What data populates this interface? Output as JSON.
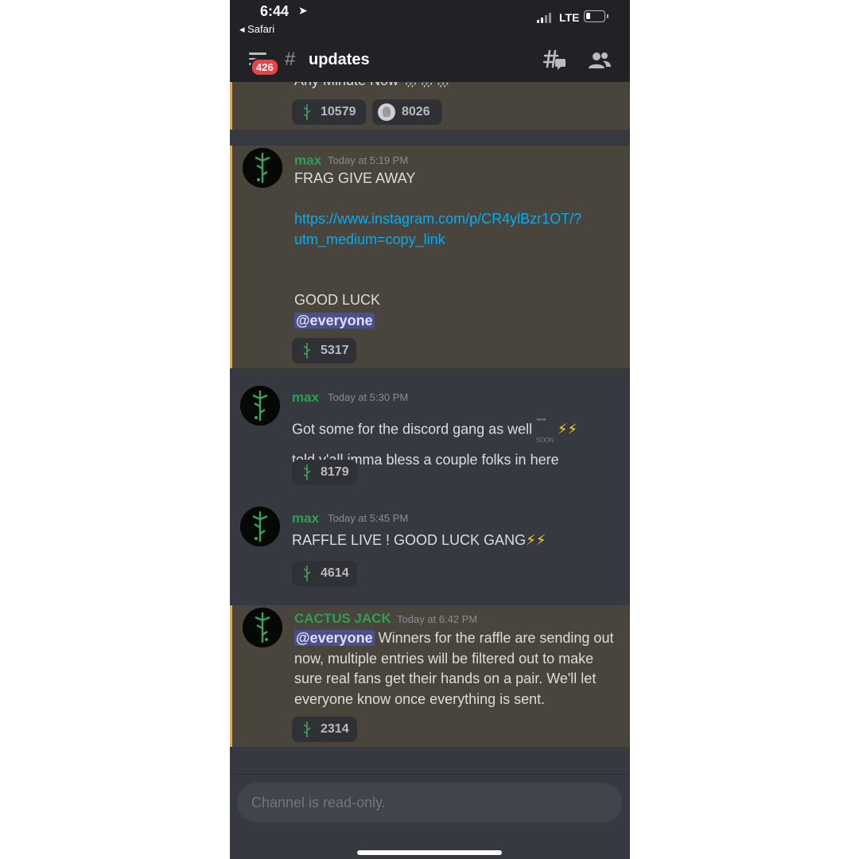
{
  "status_bar": {
    "time": "6:44",
    "back_label": "◂ Safari",
    "network": "LTE"
  },
  "header": {
    "mention_count": "426",
    "channel_prefix": "#",
    "channel_name": "updates"
  },
  "icons": {
    "menu": "hamburger-icon",
    "threads": "threads-icon",
    "members": "members-icon",
    "reaction": "cactus-emoji"
  },
  "messages": [
    {
      "partial_text": "Any Minute Now",
      "partial_emoji": "🌧🌧🌧",
      "reactions": [
        {
          "emoji": "cactus",
          "count": "10579"
        },
        {
          "emoji": "shell",
          "count": "8026"
        }
      ]
    },
    {
      "author": "max",
      "timestamp": "Today at 5:19 PM",
      "lines": [
        "FRAG GIVE AWAY",
        "",
        "https://www.instagram.com/p/CR4ylBzr1OT/?",
        "utm_medium=copy_link",
        "",
        "",
        "GOOD LUCK",
        "@everyone"
      ],
      "reactions": [
        {
          "emoji": "cactus",
          "count": "5317"
        }
      ]
    },
    {
      "author": "max",
      "timestamp": "Today at 5:30 PM",
      "lines": [
        "Got some for the discord gang as well",
        "told y'all imma bless a couple folks in here"
      ],
      "soon_label": "SOON",
      "reactions": [
        {
          "emoji": "cactus",
          "count": "8179"
        }
      ]
    },
    {
      "author": "max",
      "timestamp": "Today at 5:45 PM",
      "lines": [
        "RAFFLE LIVE ! GOOD LUCK GANG"
      ],
      "reactions": [
        {
          "emoji": "cactus",
          "count": "4614"
        }
      ]
    },
    {
      "author": "CACTUS JACK",
      "timestamp": "Today at 6:42 PM",
      "mention": "@everyone",
      "lines": [
        "Winners for the raffle are sending out",
        "now,  multiple entries will be filtered out to make",
        "sure real fans get their hands on a pair. We'll let",
        "everyone know once everything is sent."
      ],
      "reactions": [
        {
          "emoji": "cactus",
          "count": "2314"
        }
      ]
    }
  ],
  "footer": {
    "placeholder": "Channel is read-only."
  },
  "colors": {
    "background": "#36393f",
    "header": "#202225",
    "highlight": "#49443c",
    "highlight_bar": "#faa61a",
    "author_green": "#2f9e56",
    "link": "#00aff4",
    "mention_bg": "#4c4f8a",
    "badge_red": "#ed4245"
  }
}
